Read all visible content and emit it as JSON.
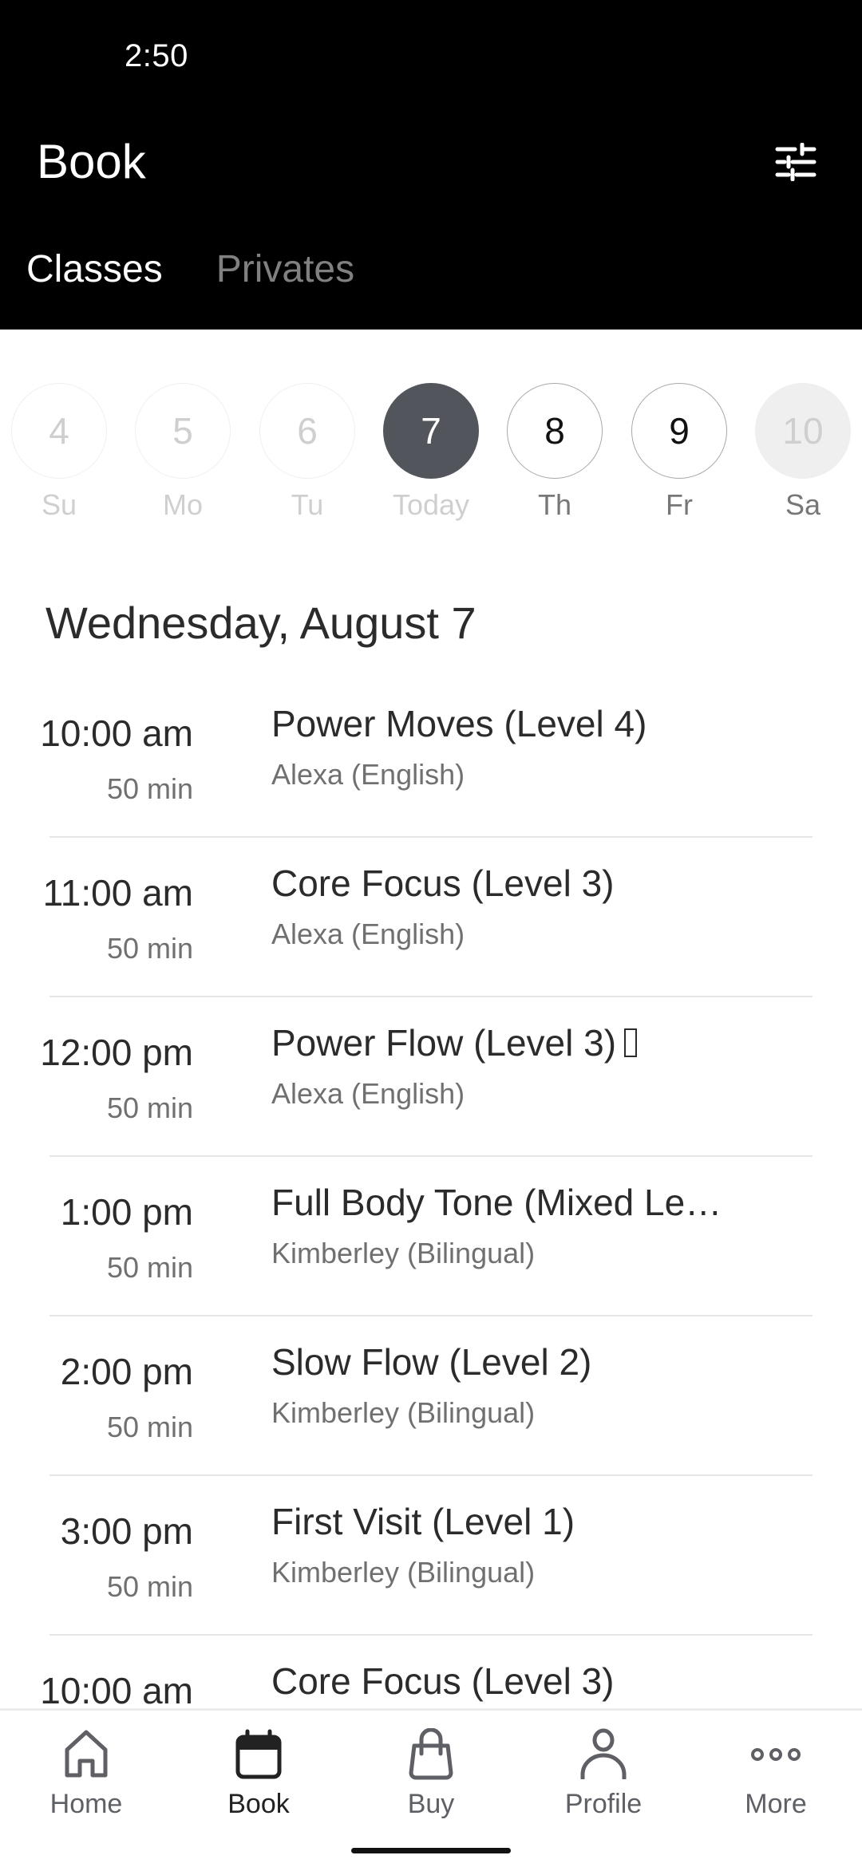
{
  "status_bar": {
    "time": "2:50"
  },
  "header": {
    "title": "Book",
    "filter_icon": "sliders-icon",
    "tabs": [
      {
        "label": "Classes",
        "active": true
      },
      {
        "label": "Privates",
        "active": false
      }
    ]
  },
  "date_strip": {
    "days": [
      {
        "number": "4",
        "label": "Su",
        "state": "past"
      },
      {
        "number": "5",
        "label": "Mo",
        "state": "past"
      },
      {
        "number": "6",
        "label": "Tu",
        "state": "past"
      },
      {
        "number": "7",
        "label": "Today",
        "state": "selected"
      },
      {
        "number": "8",
        "label": "Th",
        "state": "future"
      },
      {
        "number": "9",
        "label": "Fr",
        "state": "future"
      },
      {
        "number": "10",
        "label": "Sa",
        "state": "disabled"
      }
    ]
  },
  "schedule": {
    "date_heading": "Wednesday, August 7",
    "classes": [
      {
        "time": "10:00 am",
        "duration": "50 min",
        "name": "Power Moves (Level 4)",
        "instructor": "Alexa (English)"
      },
      {
        "time": "11:00 am",
        "duration": "50 min",
        "name": "Core Focus (Level 3)",
        "instructor": "Alexa (English)"
      },
      {
        "time": "12:00 pm",
        "duration": "50 min",
        "name": "Power Flow (Level 3)",
        "instructor": "Alexa (English)",
        "has_unknown_glyph": true
      },
      {
        "time": "1:00 pm",
        "duration": "50 min",
        "name": "Full Body Tone (Mixed Le…",
        "instructor": "Kimberley (Bilingual)"
      },
      {
        "time": "2:00 pm",
        "duration": "50 min",
        "name": "Slow Flow (Level 2)",
        "instructor": "Kimberley (Bilingual)"
      },
      {
        "time": "3:00 pm",
        "duration": "50 min",
        "name": "First Visit (Level 1)",
        "instructor": "Kimberley (Bilingual)"
      },
      {
        "time": "10:00 am",
        "duration": "",
        "name": "Core Focus (Level 3)",
        "instructor": ""
      }
    ]
  },
  "bottom_nav": {
    "items": [
      {
        "label": "Home",
        "icon": "home-icon",
        "active": false
      },
      {
        "label": "Book",
        "icon": "calendar-icon",
        "active": true
      },
      {
        "label": "Buy",
        "icon": "shopping-bag-icon",
        "active": false
      },
      {
        "label": "Profile",
        "icon": "person-icon",
        "active": false
      },
      {
        "label": "More",
        "icon": "more-dots-icon",
        "active": false
      }
    ]
  },
  "colors": {
    "header_bg": "#000000",
    "selected_day": "#53555c",
    "text_primary": "#2b2b2b",
    "text_secondary": "#707070",
    "nav_inactive": "#5e6066"
  }
}
